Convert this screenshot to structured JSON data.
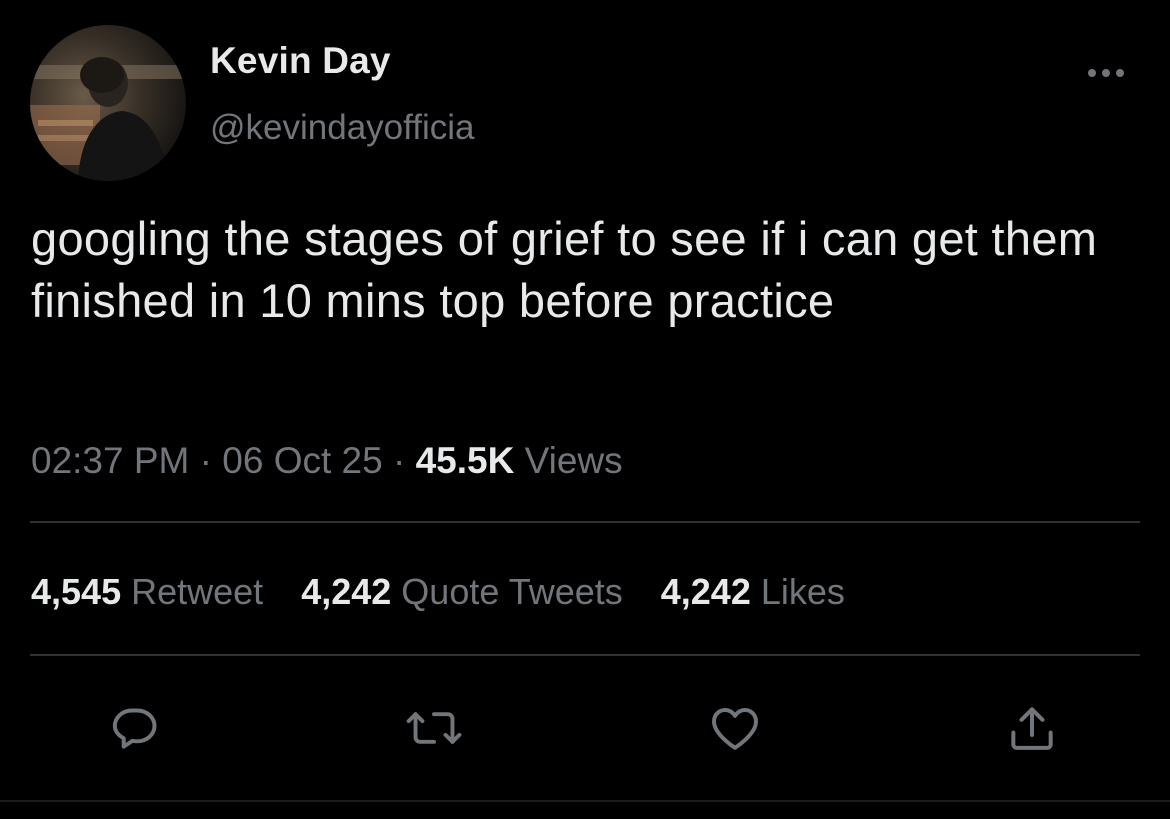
{
  "author": {
    "display_name": "Kevin Day",
    "handle": "@kevindayofficia"
  },
  "more_icon": "ellipsis-icon",
  "tweet": {
    "text": "googling the stages of grief to see if i can get them finished in 10 mins top before practice"
  },
  "meta": {
    "time": "02:37 PM",
    "sep1": "·",
    "date": "06 Oct 25",
    "sep2": "·",
    "views_count": "45.5K",
    "views_label": "Views"
  },
  "stats": {
    "retweets": {
      "count": "4,545",
      "label": "Retweet"
    },
    "quotes": {
      "count": "4,242",
      "label": "Quote Tweets"
    },
    "likes": {
      "count": "4,242",
      "label": "Likes"
    }
  },
  "actions": [
    {
      "icon": "reply-icon"
    },
    {
      "icon": "retweet-icon"
    },
    {
      "icon": "heart-icon"
    },
    {
      "icon": "share-icon"
    }
  ],
  "colors": {
    "background": "#000000",
    "primary_text": "#e7e9ea",
    "secondary_text": "#71767b",
    "divider": "#2f3336"
  }
}
